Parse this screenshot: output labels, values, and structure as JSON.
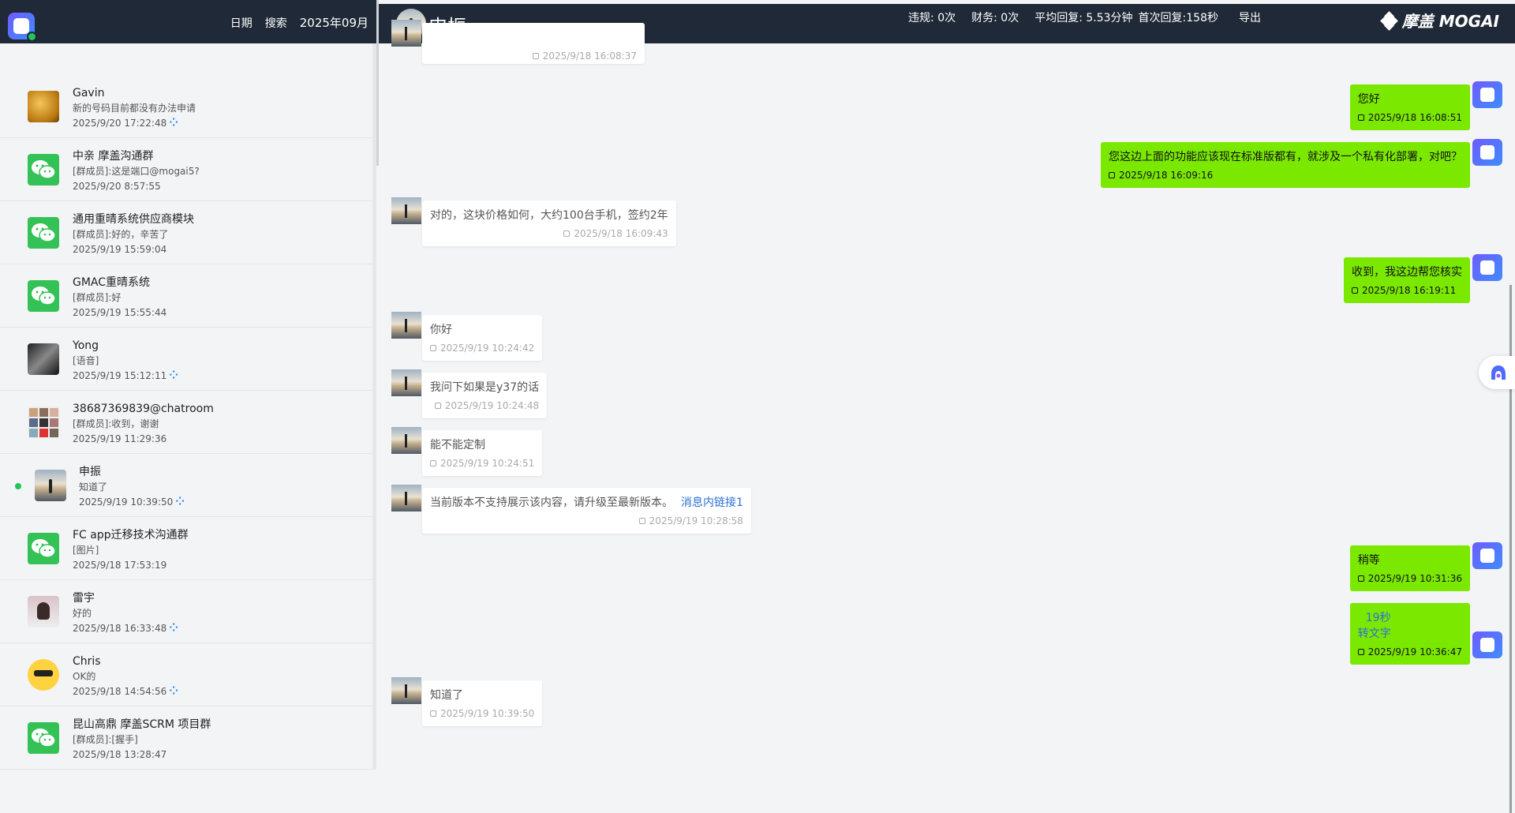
{
  "sidebar": {
    "nav": {
      "date": "日期",
      "search": "搜索",
      "month": "2025年09月"
    },
    "conversations": [
      {
        "name": "Gavin",
        "preview": "新的号码目前都没有办法申请",
        "time": "2025/9/20 17:22:48",
        "avatar": "photo-golden-icon",
        "loading": true
      },
      {
        "name": "中亲 摩盖沟通群",
        "preview": "[群成员]:这是端口@mogai5?",
        "time": "2025/9/20 8:57:55",
        "avatar": "wechat-icon",
        "loading": false
      },
      {
        "name": "通用重晴系统供应商模块",
        "preview": "[群成员]:好的，辛苦了",
        "time": "2025/9/19 15:59:04",
        "avatar": "wechat-icon",
        "loading": false
      },
      {
        "name": "GMAC重晴系统",
        "preview": "[群成员]:好",
        "time": "2025/9/19 15:55:44",
        "avatar": "wechat-icon",
        "loading": false
      },
      {
        "name": "Yong",
        "preview": "[语音]",
        "time": "2025/9/19 15:12:11",
        "avatar": "photo-bw-icon",
        "loading": true
      },
      {
        "name": "38687369839@chatroom",
        "preview": "[群成员]:收到，谢谢",
        "time": "2025/9/19 11:29:36",
        "avatar": "group-grid-icon",
        "loading": false
      },
      {
        "name": "申振",
        "preview": "知道了",
        "time": "2025/9/19 10:39:50",
        "avatar": "sunset-icon",
        "loading": true,
        "active": true
      },
      {
        "name": "FC app迁移技术沟通群",
        "preview": "[图片]",
        "time": "2025/9/18 17:53:19",
        "avatar": "wechat-icon",
        "loading": false
      },
      {
        "name": "雷宇",
        "preview": "好的",
        "time": "2025/9/18 16:33:48",
        "avatar": "photo-girl-icon",
        "loading": true
      },
      {
        "name": "Chris",
        "preview": "OK的",
        "time": "2025/9/18 14:54:56",
        "avatar": "cartoon-icon",
        "loading": true
      },
      {
        "name": "昆山高鼎 摩盖SCRM 项目群",
        "preview": "[群成员]:[握手]",
        "time": "2025/9/18 13:28:47",
        "avatar": "wechat-icon",
        "loading": false
      }
    ]
  },
  "chat": {
    "contact_name": "申振",
    "stats": {
      "violations_label": "违规: 0次",
      "finance_label": "财务: 0次",
      "avg_reply_label": "平均回复: 5.53分钟",
      "first_reply_label": "首次回复:158秒"
    },
    "export_label": "导出",
    "brand": "摩盖 MOGAI",
    "messages": [
      {
        "dir": "in",
        "text": "",
        "time": "2025/9/18 16:08:37"
      },
      {
        "dir": "out",
        "text": "您好",
        "time": "2025/9/18 16:08:51"
      },
      {
        "dir": "out",
        "text": "您这边上面的功能应该现在标准版都有，就涉及一个私有化部署，对吧？",
        "time": "2025/9/18 16:09:16"
      },
      {
        "dir": "in",
        "text": "对的，这块价格如何，大约100台手机，签约2年",
        "time": "2025/9/18 16:09:43"
      },
      {
        "dir": "out",
        "text": "收到，我这边帮您核实",
        "time": "2025/9/18 16:19:11"
      },
      {
        "dir": "in",
        "text": "你好",
        "time": "2025/9/19 10:24:42"
      },
      {
        "dir": "in",
        "text": "我问下如果是y37的话",
        "time": "2025/9/19 10:24:48"
      },
      {
        "dir": "in",
        "text": "能不能定制",
        "time": "2025/9/19 10:24:51"
      },
      {
        "dir": "in",
        "text": "当前版本不支持展示该内容，请升级至最新版本。",
        "link": "消息内链接1",
        "time": "2025/9/19 10:28:58"
      },
      {
        "dir": "out",
        "text": "稍等",
        "time": "2025/9/19 10:31:36"
      },
      {
        "dir": "out",
        "voice_duration": "19秒",
        "voice_to_text": "转文字",
        "time": "2025/9/19 10:36:47"
      },
      {
        "dir": "in",
        "text": "知道了",
        "time": "2025/9/19 10:39:50"
      }
    ]
  },
  "colors": {
    "header_bg": "#1f2937",
    "outgoing_bubble": "#7be800",
    "link": "#2b6fd6",
    "online": "#22c55e"
  }
}
